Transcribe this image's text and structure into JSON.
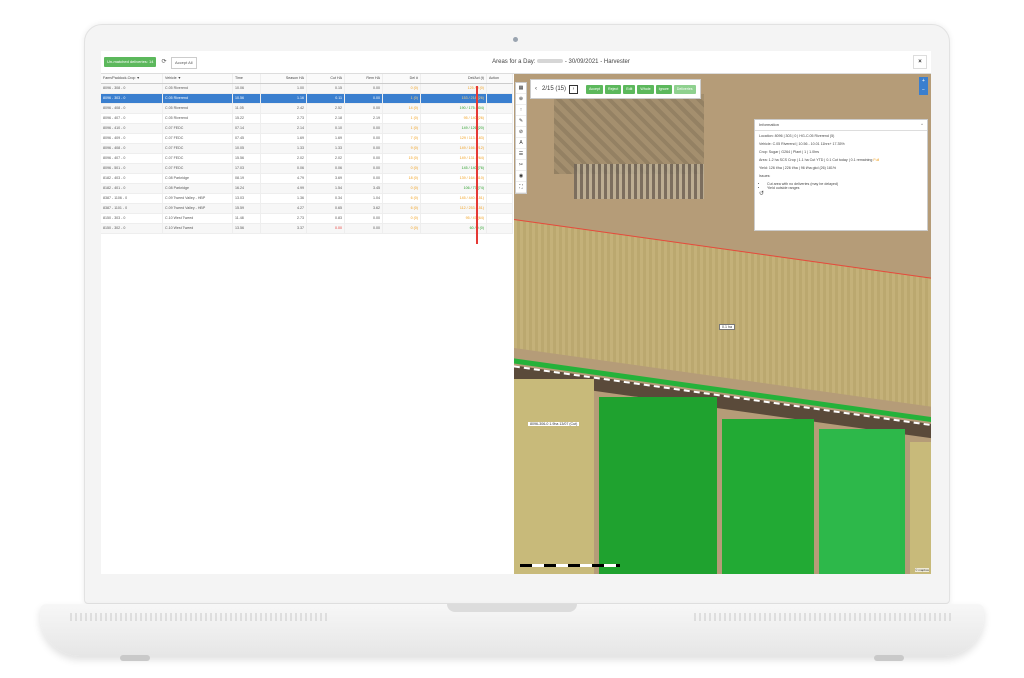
{
  "toolbar": {
    "unmatched_label": "Un-matched deliveries: 14",
    "refresh_icon": "refresh-icon",
    "accept_all_label": "Accept All",
    "title_prefix": "Areas for a Day:",
    "title_suffix": "- 30/09/2021 - Harvester",
    "close_label": "×"
  },
  "table": {
    "headers": [
      "Farm/Paddock-Crop",
      "Vehicle",
      "Time",
      "Season HA",
      "Cut HA",
      "Rem HA",
      "Del #",
      "Del/Act (t)",
      "Action"
    ],
    "rows": [
      {
        "fpc": "8096 - 308 - 0",
        "vehicle": "C.05 Riverend",
        "time": "10.06",
        "season": "1.00",
        "cut": "0.15",
        "rem": "0.00",
        "del": "0 (0)",
        "delact": "125 / 0 (0)"
      },
      {
        "fpc": "8096 - 303 - 0",
        "vehicle": "C.05 Riverend",
        "time": "10.56",
        "season": "1.16",
        "cut": "0.11",
        "rem": "0.00",
        "del": "1 (0)",
        "delact": "153 / 218 (26)"
      },
      {
        "fpc": "8096 - 408 - 0",
        "vehicle": "C.05 Riverend",
        "time": "11.05",
        "season": "2.42",
        "cut": "2.52",
        "rem": "0.00",
        "del": "14 (0)",
        "delact": "190 / 175 (304)"
      },
      {
        "fpc": "8096 - 407 - 0",
        "vehicle": "C.05 Riverend",
        "time": "15.22",
        "season": "2.73",
        "cut": "2.18",
        "rem": "2.19",
        "del": "1 (0)",
        "delact": "95 / 140 (26)"
      },
      {
        "fpc": "8096 - 410 - 0",
        "vehicle": "C.07 FEDC",
        "time": "07.14",
        "season": "2.14",
        "cut": "0.10",
        "rem": "0.00",
        "del": "1 (0)",
        "delact": "149 / 126 (20)"
      },
      {
        "fpc": "8096 - 409 - 0",
        "vehicle": "C.07 FEDC",
        "time": "07.45",
        "season": "1.69",
        "cut": "1.69",
        "rem": "0.00",
        "del": "7 (0)",
        "delact": "129 / 113 (183)"
      },
      {
        "fpc": "8096 - 408 - 0",
        "vehicle": "C.07 FEDC",
        "time": "10.05",
        "season": "1.33",
        "cut": "1.33",
        "rem": "0.00",
        "del": "9 (0)",
        "delact": "149 / 166 (212)"
      },
      {
        "fpc": "8096 - 407 - 0",
        "vehicle": "C.07 FEDC",
        "time": "15.56",
        "season": "2.02",
        "cut": "2.02",
        "rem": "0.00",
        "del": "15 (0)",
        "delact": "149 / 131 (264)"
      },
      {
        "fpc": "8096 - 501 - 0",
        "vehicle": "C.07 FEDC",
        "time": "17.03",
        "season": "0.06",
        "cut": "0.06",
        "rem": "0.00",
        "del": "0 (0)",
        "delact": "145 / 140 (76)"
      },
      {
        "fpc": "8182 - 403 - 0",
        "vehicle": "C.08 Parkridge",
        "time": "08.19",
        "season": "4.79",
        "cut": "3.69",
        "rem": "0.00",
        "del": "18 (0)",
        "delact": "139 / 164 (410)"
      },
      {
        "fpc": "8182 - 401 - 0",
        "vehicle": "C.08 Parkridge",
        "time": "16.24",
        "season": "4.99",
        "cut": "1.54",
        "rem": "3.45",
        "del": "0 (0)",
        "delact": "106 / 77 (74)"
      },
      {
        "fpc": "8387 - 1106 - 0",
        "vehicle": "C.09 Tweed Valley - HBP",
        "time": "13.03",
        "season": "1.36",
        "cut": "0.34",
        "rem": "1.04",
        "del": "6 (0)",
        "delact": "145 / 440 (151)"
      },
      {
        "fpc": "8387 - 1101 - 0",
        "vehicle": "C.09 Tweed Valley - HBP",
        "time": "15.59",
        "season": "4.27",
        "cut": "0.65",
        "rem": "3.62",
        "del": "6 (0)",
        "delact": "112 / 253 (151)"
      },
      {
        "fpc": "8150 - 303 - 0",
        "vehicle": "C.10 West Tweed",
        "time": "11.48",
        "season": "2.73",
        "cut": "0.83",
        "rem": "0.00",
        "del": "0 (0)",
        "delact": "95 / 47 (64)"
      },
      {
        "fpc": "8150 - 302 - 0",
        "vehicle": "C.10 West Tweed",
        "time": "13.56",
        "season": "3.37",
        "cut": "0.00",
        "rem": "0.00",
        "del": "0 (0)",
        "delact": "60 / 0 (0)"
      }
    ]
  },
  "map": {
    "pager": "2/15 (15)",
    "buttons": [
      "Accept",
      "Reject",
      "Edit",
      "Whole",
      "Ignore",
      "Deliveries"
    ],
    "left_tools": [
      "▦",
      "⊕",
      "↑",
      "✎",
      "⊘",
      "A",
      "☰",
      "✂",
      "◉",
      "⛶"
    ],
    "right_tools": [
      "+",
      "−"
    ],
    "info": {
      "title": "Information",
      "collapse": "^",
      "location": "Location: 8096 | 303 | 0 | HG-C.05 Riverend (5)",
      "vehicle": "Vehicle: C.05 Riverend | 10.56 - 10.01 11hrs+ 17.35%",
      "crop": "Crop: Sugar | G264 | Plant | 1 | 1.0hrs",
      "area": "Area: 1.2 ha SCS Crop | 1.1 ha Cut YTD | 0.1 Cut today | 0.1 remaining",
      "area_hl": "Full",
      "yield": "Yield: 126 t/ha | 226 t/ha | 96 t/ha gkd (26) 181%",
      "issues_label": "Issues:",
      "issues": [
        "Cut area with no deliveries (may be delayed)",
        "Yield outside ranges"
      ]
    },
    "field_label": "0.1 ha",
    "paddock_label": "8096-306-0 1.9ha 13/07 (Cut)",
    "attribution": "© mapbox"
  }
}
